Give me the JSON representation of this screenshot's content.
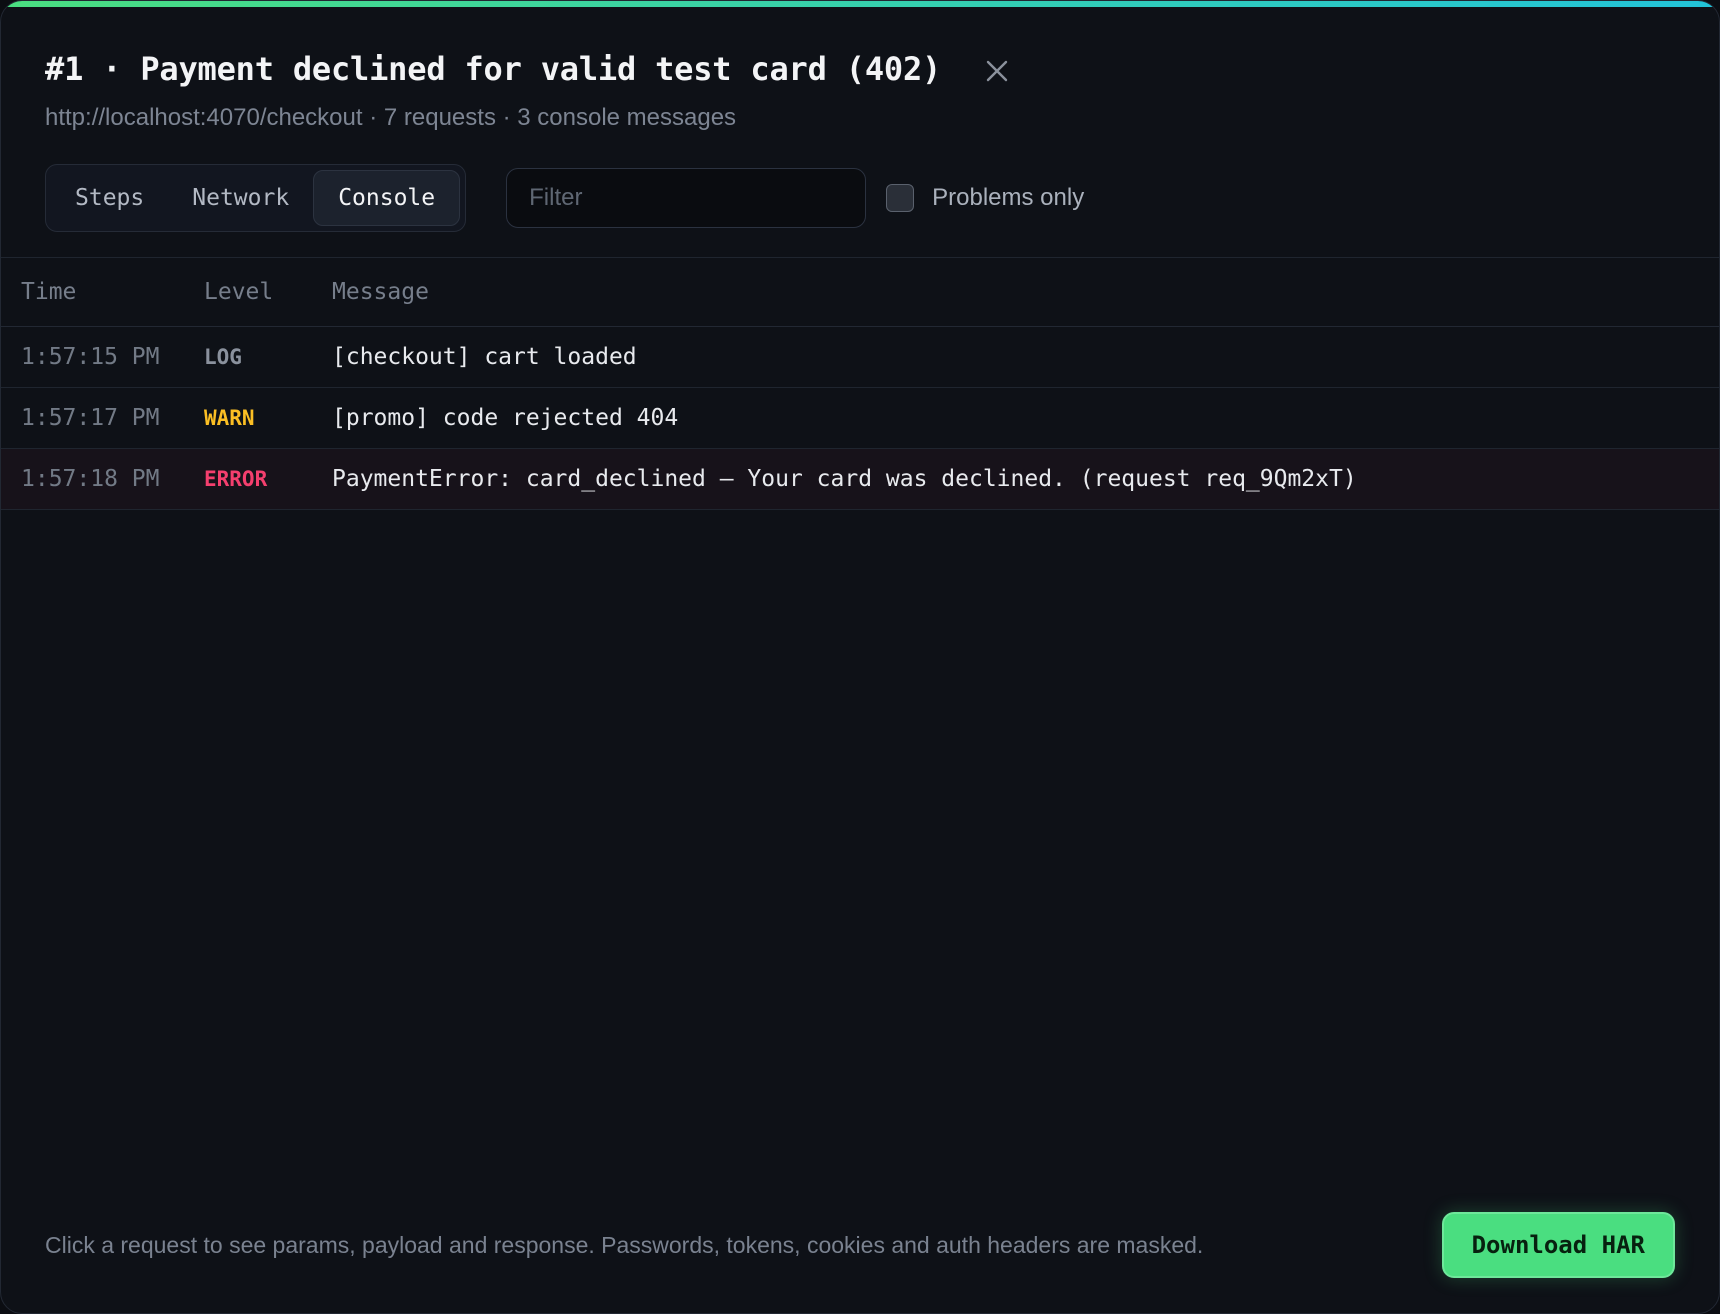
{
  "header": {
    "title": "#1 · Payment declined for valid test card (402)",
    "subtitle": "http://localhost:4070/checkout · 7 requests · 3 console messages",
    "close_icon": "close-icon"
  },
  "tabs": [
    {
      "label": "Steps",
      "active": false
    },
    {
      "label": "Network",
      "active": false
    },
    {
      "label": "Console",
      "active": true
    }
  ],
  "filter": {
    "placeholder": "Filter",
    "value": ""
  },
  "problems_only": {
    "label": "Problems only",
    "checked": false
  },
  "table": {
    "columns": [
      "Time",
      "Level",
      "Message"
    ],
    "rows": [
      {
        "time": "1:57:15 PM",
        "level": "LOG",
        "message": "[checkout] cart loaded"
      },
      {
        "time": "1:57:17 PM",
        "level": "WARN",
        "message": "[promo] code rejected 404"
      },
      {
        "time": "1:57:18 PM",
        "level": "ERROR",
        "message": "PaymentError: card_declined — Your card was declined. (request req_9Qm2xT)"
      }
    ]
  },
  "footer": {
    "note": "Click a request to see params, payload and response. Passwords, tokens, cookies and auth headers are masked.",
    "download_label": "Download HAR"
  },
  "colors": {
    "accent_start": "#4ade80",
    "accent_end": "#22c3d9",
    "warn": "#fbbf24",
    "error": "#f43f6e",
    "background": "#0e1117"
  }
}
